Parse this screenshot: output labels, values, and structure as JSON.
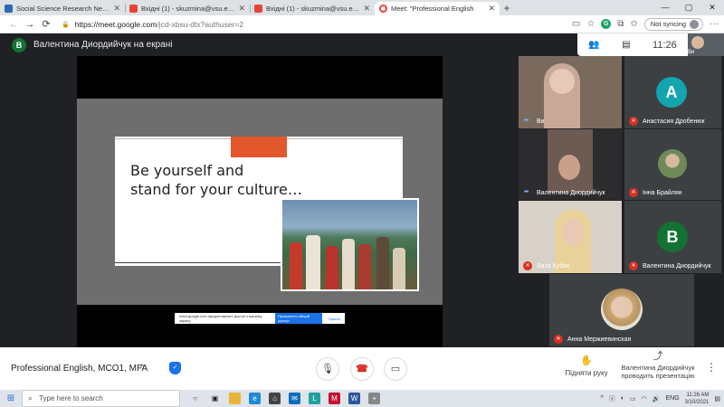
{
  "browser": {
    "tabs": [
      {
        "title": "Social Science Research Network",
        "favicon_color": "#2b6cb0",
        "active": false
      },
      {
        "title": "Вхідні (1) - skuzmina@vsu.edu",
        "favicon_color": "#ea4335",
        "active": false
      },
      {
        "title": "Вхідні (1) - skuzmina@vsu.edu",
        "favicon_color": "#ea4335",
        "active": false
      },
      {
        "title": "Meet: \"Professional English",
        "favicon_color": "#ea4335",
        "active": true
      }
    ],
    "new_tab": "+",
    "url_host": "https://meet.google.com",
    "url_rest": "/jcd-xbsu-dtx?authuser=2",
    "sync_label": "Not syncing",
    "window_controls": [
      "—",
      "▢",
      "✕"
    ]
  },
  "meet": {
    "presenter_initial": "В",
    "presenter_banner": "Валентина Диордийчук на екрані",
    "time": "11:26",
    "self_mini_label": "Ви",
    "slide": {
      "line1": "Be yourself and",
      "line2": "stand for your culture…"
    },
    "notice": {
      "text": "meet.google.com предоставляет доступ к вашему экрану",
      "button": "Прекратить общий доступ",
      "link": "Скрыть"
    },
    "participants": [
      {
        "name": "Ви",
        "type": "video",
        "muted": false
      },
      {
        "name": "Анастасия Дробенюк",
        "type": "avatar",
        "initial": "А",
        "color": "#12a4af",
        "muted": true
      },
      {
        "name": "Валентина Диордийчук",
        "type": "video",
        "muted": false
      },
      {
        "name": "Інна Брайлян",
        "type": "photo",
        "muted": true
      },
      {
        "name": "Лиза Кубик",
        "type": "video",
        "muted": true
      },
      {
        "name": "Валентина Диордийчук",
        "type": "avatar",
        "initial": "В",
        "color": "#137333",
        "muted": true
      },
      {
        "name": "Анна Мержиевинская",
        "type": "photo",
        "muted": true
      }
    ],
    "meeting_title": "Professional English, MCO1, MFA",
    "raise_hand": "Підняти руку",
    "presenting_now": "Валентина Диордийчук проводить презентацію"
  },
  "taskbar": {
    "search_placeholder": "Type here to search",
    "lang": "ENG",
    "time": "11:26 AM",
    "date": "3/10/2021",
    "notifications": "1"
  },
  "colors": {
    "meet_bg": "#202124",
    "accent_orange": "#e2582c",
    "end_call_red": "#d93025"
  }
}
